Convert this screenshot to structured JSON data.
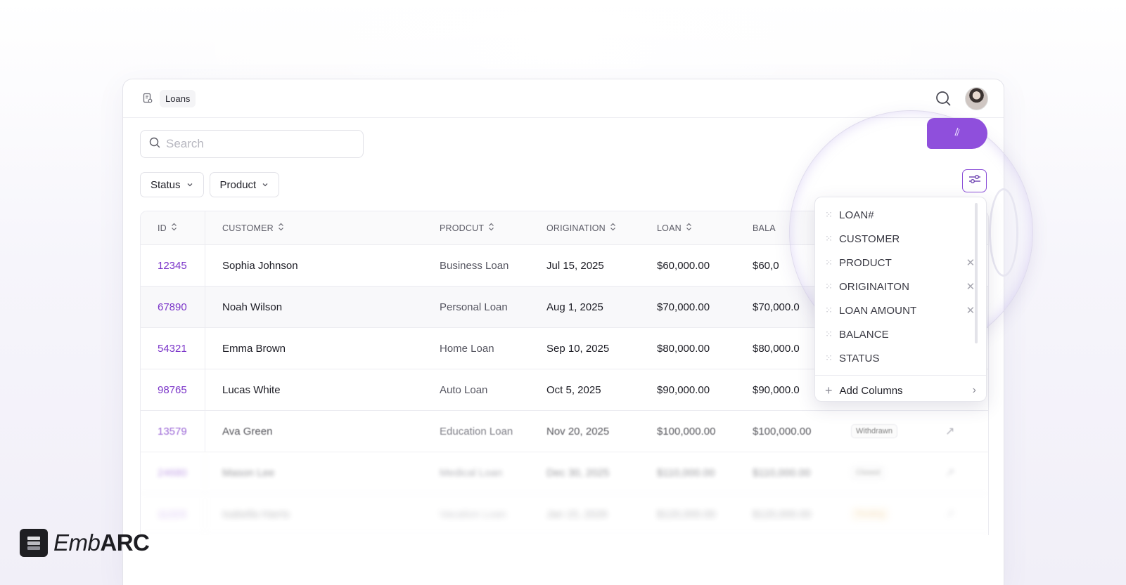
{
  "breadcrumb": {
    "label": "Loans"
  },
  "search": {
    "placeholder": "Search"
  },
  "filters": [
    {
      "label": "Status"
    },
    {
      "label": "Product"
    }
  ],
  "table": {
    "columns": [
      "ID",
      "CUSTOMER",
      "PRODCUT",
      "ORIGINATION",
      "LOAN",
      "BALA"
    ],
    "rows": [
      {
        "id": "12345",
        "customer": "Sophia Johnson",
        "product": "Business Loan",
        "origination": "Jul 15, 2025",
        "loan": "$60,000.00",
        "balance": "$60,0",
        "status": ""
      },
      {
        "id": "67890",
        "customer": "Noah Wilson",
        "product": "Personal Loan",
        "origination": "Aug 1, 2025",
        "loan": "$70,000.00",
        "balance": "$70,000.0",
        "status": ""
      },
      {
        "id": "54321",
        "customer": "Emma Brown",
        "product": "Home Loan",
        "origination": "Sep 10, 2025",
        "loan": "$80,000.00",
        "balance": "$80,000.0",
        "status": ""
      },
      {
        "id": "98765",
        "customer": "Lucas White",
        "product": "Auto Loan",
        "origination": "Oct 5, 2025",
        "loan": "$90,000.00",
        "balance": "$90,000.0",
        "status": ""
      },
      {
        "id": "13579",
        "customer": "Ava Green",
        "product": "Education Loan",
        "origination": "Nov 20, 2025",
        "loan": "$100,000.00",
        "balance": "$100,000.00",
        "status": "Withdrawn"
      },
      {
        "id": "24680",
        "customer": "Mason Lee",
        "product": "Medical Loan",
        "origination": "Dec 30, 2025",
        "loan": "$110,000.00",
        "balance": "$110,000.00",
        "status": "Closed"
      },
      {
        "id": "11223",
        "customer": "Isabella Harris",
        "product": "Vacation Loan",
        "origination": "Jan 15, 2026",
        "loan": "$120,000.00",
        "balance": "$120,000.00",
        "status": "Pending"
      }
    ]
  },
  "column_menu": {
    "items": [
      {
        "label": "LOAN#",
        "removable": false
      },
      {
        "label": "CUSTOMER",
        "removable": false
      },
      {
        "label": "PRODUCT",
        "removable": true
      },
      {
        "label": "ORIGINAITON",
        "removable": true
      },
      {
        "label": "LOAN AMOUNT",
        "removable": true
      },
      {
        "label": "BALANCE",
        "removable": false
      },
      {
        "label": "STATUS",
        "removable": false
      }
    ],
    "add_label": "Add Columns"
  },
  "logo": {
    "part1": "Emb",
    "part2": "ARC"
  },
  "colors": {
    "accent": "#8f4fdc",
    "link": "#7b35c9"
  }
}
